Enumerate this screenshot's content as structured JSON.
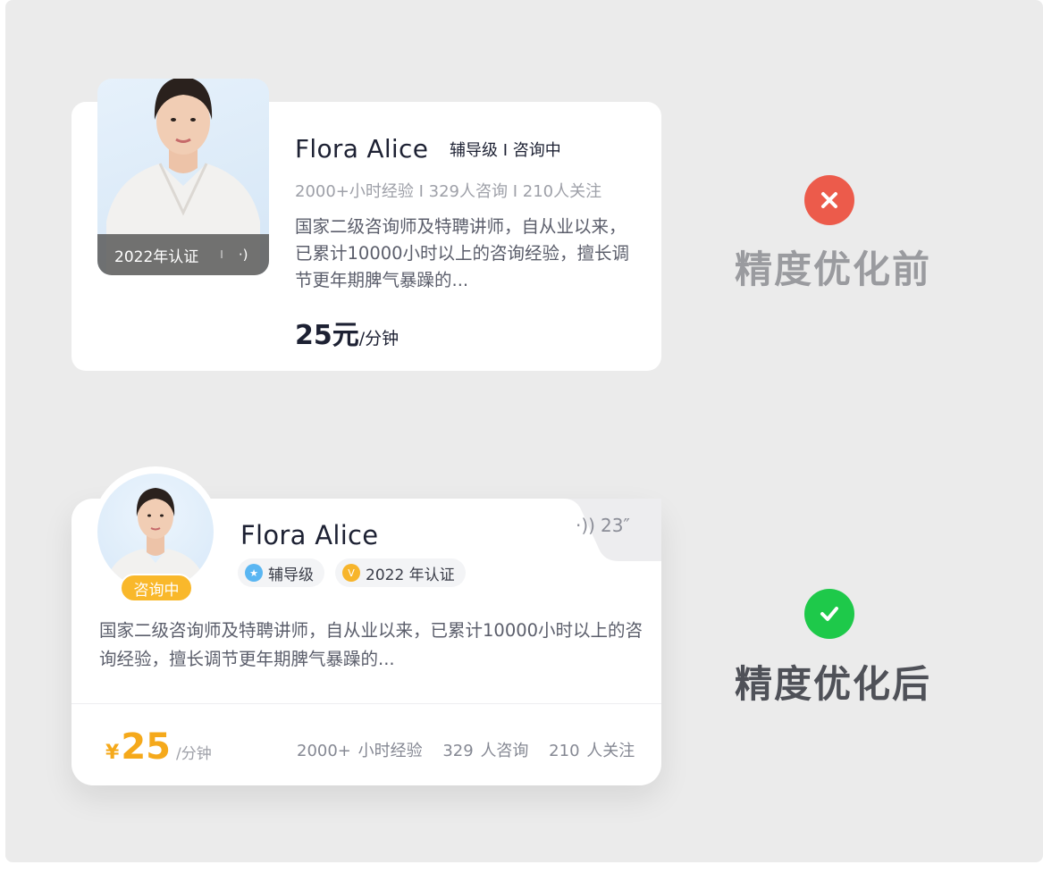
{
  "before": {
    "name": "Flora Alice",
    "level_status": "辅导级 I 咨询中",
    "stats": "2000+小时经验 I 329人咨询 I 210人关注",
    "description": "国家二级咨询师及特聘讲师，自从业以来，已累计10000小时以上的咨询经验，擅长调节更年期脾气暴躁的...",
    "cert_label": "2022年认证",
    "cert_separator": "I",
    "price_value": "25元",
    "price_unit": "/分钟",
    "caption": "精度优化前",
    "status_icon": "close-icon"
  },
  "after": {
    "name": "Flora Alice",
    "voice_duration": "23″",
    "consult_status": "咨询中",
    "tag_level": "辅导级",
    "tag_cert": "2022 年认证",
    "description": "国家二级咨询师及特聘讲师，自从业以来，已累计10000小时以上的咨询经验，擅长调节更年期脾气暴躁的...",
    "currency": "¥",
    "price_value": "25",
    "price_unit": "/分钟",
    "stat_hours": "2000+ 小时经验",
    "stat_consults": "329 人咨询",
    "stat_followers": "210 人关注",
    "caption": "精度优化后",
    "status_icon": "check-icon"
  },
  "colors": {
    "accent_price": "#f5a91b",
    "error": "#ec5b4b",
    "success": "#1ec94a",
    "level_badge": "#5ab6f2",
    "cert_badge": "#f7b52c",
    "consult_badge": "#f9b82b"
  }
}
